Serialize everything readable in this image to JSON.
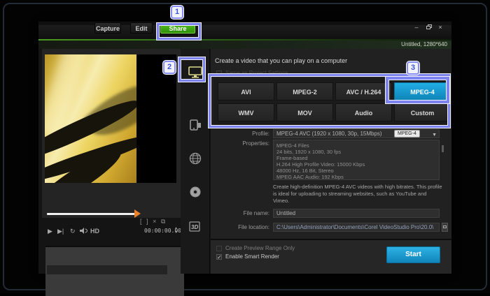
{
  "colors": {
    "accent_green": "#3aa112",
    "accent_blue": "#189ad2",
    "annotation_purple": "#7d84f0"
  },
  "callouts": {
    "step1": "1",
    "step2": "2",
    "step3": "3"
  },
  "titlebar": {
    "project_info": "Untitled, 1280*640"
  },
  "tabs": [
    {
      "label": "Capture"
    },
    {
      "label": "Edit"
    },
    {
      "label": "Share",
      "active": true
    }
  ],
  "icons": {
    "minimize": "–",
    "close": "×",
    "play": "▶",
    "next_frame": "▶|",
    "repeat": "↻",
    "hd": "HD",
    "mark_in": "[",
    "mark_out": "]",
    "clear": "×",
    "caret_down": "▼",
    "spin_up": "▴",
    "spin_down": "▾",
    "check": "✓"
  },
  "player": {
    "timecode": "00:00:00.00"
  },
  "share_destinations": [
    {
      "name": "computer",
      "selected": true
    },
    {
      "name": "device"
    },
    {
      "name": "web"
    },
    {
      "name": "disc"
    },
    {
      "name": "3d-movie"
    }
  ],
  "panel": {
    "header": "Create a video that you can play on a computer",
    "same_as_project_label": "Same as Project Settings",
    "formats": [
      {
        "label": "AVI"
      },
      {
        "label": "MPEG-2"
      },
      {
        "label": "AVC / H.264"
      },
      {
        "label": "MPEG-4",
        "selected": true
      },
      {
        "label": "WMV"
      },
      {
        "label": "MOV"
      },
      {
        "label": "Audio"
      },
      {
        "label": "Custom"
      }
    ],
    "tooltip": "MPEG-4",
    "profile_label": "Profile:",
    "profile_value": "MPEG-4 AVC (1920 x 1080, 30p, 15Mbps)",
    "properties_label": "Properties:",
    "properties_lines": [
      "MPEG-4 Files",
      "24 bits, 1920 x 1080, 30 fps",
      "Frame-based",
      "H.264 High Profile Video: 15000 Kbps",
      "48000 Hz, 16 Bit, Stereo",
      "MPEG AAC Audio: 192 Kbps"
    ],
    "description": "Create high-definition MPEG-4 AVC videos with high bitrates. This profile is ideal for uploading to streaming websites, such as YouTube and Vimeo.",
    "file_name_label": "File name:",
    "file_name_value": "Untitled",
    "file_location_label": "File location:",
    "file_location_value": "C:\\Users\\Administrator\\Documents\\Corel VideoStudio Pro\\20.0\\",
    "preview_range_label": "Create Preview Range Only",
    "smart_render_label": "Enable Smart Render",
    "start_label": "Start"
  }
}
